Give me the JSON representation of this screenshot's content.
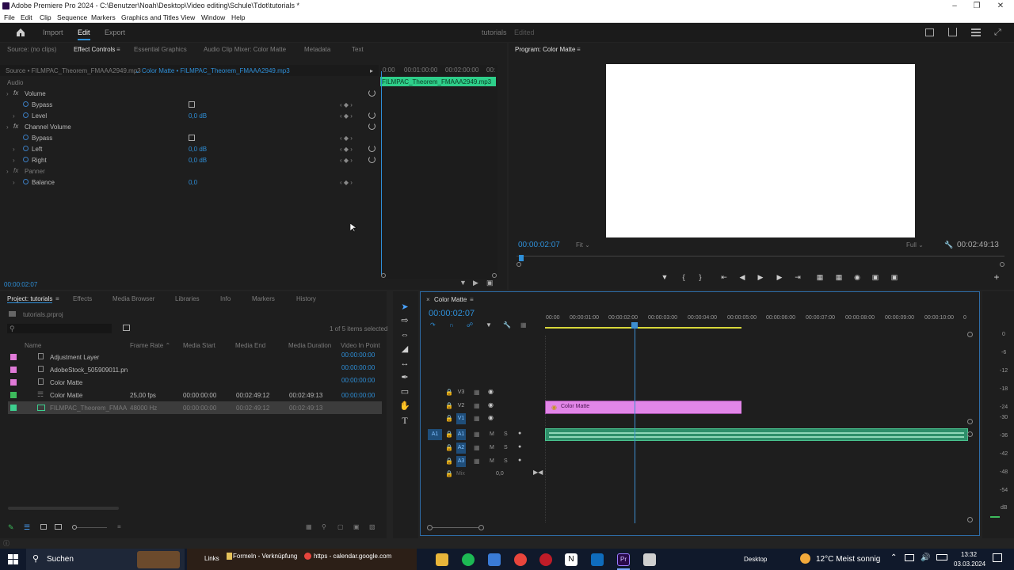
{
  "window": {
    "title": "Adobe Premiere Pro 2024 - C:\\Benutzer\\Noah\\Desktop\\Video editing\\Schule\\Tdot\\tutorials *"
  },
  "menu": [
    "File",
    "Edit",
    "Clip",
    "Sequence",
    "Markers",
    "Graphics and Titles",
    "View",
    "Window",
    "Help"
  ],
  "workspace": {
    "tabs": [
      "Import",
      "Edit",
      "Export"
    ],
    "active": "Edit",
    "project_name": "tutorials",
    "status": "Edited"
  },
  "effect_controls": {
    "tabs": [
      "Source: (no clips)",
      "Effect Controls",
      "Essential Graphics",
      "Audio Clip Mixer: Color Matte",
      "Metadata",
      "Text"
    ],
    "source": "Source • FILMPAC_Theorem_FMAAA2949.mp3",
    "clip": "Color Matte • FILMPAC_Theorem_FMAAA2949.mp3",
    "section": "Audio",
    "rows": [
      {
        "label": "Volume",
        "value": ""
      },
      {
        "label": "Bypass",
        "value": ""
      },
      {
        "label": "Level",
        "value": "0,0 dB"
      },
      {
        "label": "Channel Volume",
        "value": ""
      },
      {
        "label": "Bypass",
        "value": ""
      },
      {
        "label": "Left",
        "value": "0,0 dB"
      },
      {
        "label": "Right",
        "value": "0,0 dB"
      },
      {
        "label": "Panner",
        "value": ""
      },
      {
        "label": "Balance",
        "value": "0,0"
      }
    ],
    "mini_ruler": [
      "0:00",
      "00:01:00:00",
      "00:02:00:00",
      "00:"
    ],
    "mini_clip": "FILMPAC_Theorem_FMAAA2949.mp3",
    "timecode": "00:00:02:07"
  },
  "program": {
    "title": "Program: Color Matte",
    "timecode": "00:00:02:07",
    "fit": "Fit",
    "quality": "Full",
    "duration": "00:02:49:13"
  },
  "project": {
    "tabs": [
      "Project: tutorials",
      "Effects",
      "Media Browser",
      "Libraries",
      "Info",
      "Markers",
      "History"
    ],
    "file": "tutorials.prproj",
    "selection": "1 of 5 items selected",
    "columns": [
      "Name",
      "Frame Rate",
      "Media Start",
      "Media End",
      "Media Duration",
      "Video In Point"
    ],
    "items": [
      {
        "name": "Adjustment Layer",
        "color": "#e07ad8",
        "fps": "",
        "start": "",
        "end": "",
        "dur": "",
        "in": "00:00:00:00"
      },
      {
        "name": "AdobeStock_505909011.pn",
        "color": "#e07ad8",
        "fps": "",
        "start": "",
        "end": "",
        "dur": "",
        "in": "00:00:00:00"
      },
      {
        "name": "Color Matte",
        "color": "#e07ad8",
        "fps": "",
        "start": "",
        "end": "",
        "dur": "",
        "in": "00:00:00:00"
      },
      {
        "name": "Color Matte",
        "color": "#3dbb5c",
        "fps": "25,00 fps",
        "start": "00:00:00:00",
        "end": "00:02:49:12",
        "dur": "00:02:49:13",
        "in": "00:00:00:00"
      },
      {
        "name": "FILMPAC_Theorem_FMAA",
        "color": "#3dcf8e",
        "fps": "48000 Hz",
        "start": "00:00:00:00",
        "end": "00:02:49:12",
        "dur": "00:02:49:13",
        "in": ""
      }
    ]
  },
  "timeline": {
    "title": "Color Matte",
    "timecode": "00:00:02:07",
    "ruler": [
      "00:00",
      "00:00:01:00",
      "00:00:02:00",
      "00:00:03:00",
      "00:00:04:00",
      "00:00:05:00",
      "00:00:06:00",
      "00:00:07:00",
      "00:00:08:00",
      "00:00:09:00",
      "00:00:10:00",
      "0"
    ],
    "video_tracks": [
      "V3",
      "V2",
      "V1"
    ],
    "audio_tracks": [
      "A1",
      "A2",
      "A3"
    ],
    "source_patch": "A1",
    "mix_label": "Mix",
    "mix_value": "0,0",
    "clip_label": "Color Matte",
    "meter_labels": [
      "0",
      "-6",
      "-12",
      "-18",
      "-24",
      "-30",
      "-36",
      "-42",
      "-48",
      "-54",
      "dB"
    ]
  },
  "taskbar": {
    "search": "Suchen",
    "items": [
      "Links",
      "Formeln - Verknüpfung",
      "https - calendar.google.com"
    ],
    "desktop": "Desktop",
    "weather": "12°C  Meist sonnig",
    "time": "13:32",
    "date": "03.03.2024"
  }
}
